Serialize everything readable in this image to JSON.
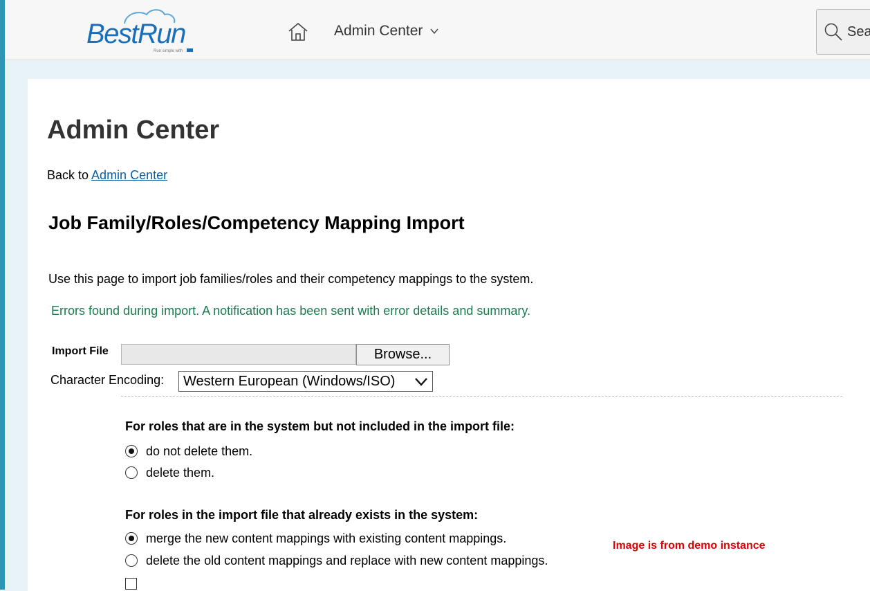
{
  "header": {
    "logo_text": "BestRun",
    "logo_tagline": "Run simple with",
    "nav_label": "Admin Center",
    "search_text": "Sear"
  },
  "page": {
    "title": "Admin Center",
    "back_prefix": "Back to",
    "back_link": "Admin Center",
    "section_title": "Job Family/Roles/Competency Mapping Import",
    "intro": "Use this page to import job families/roles and their competency mappings to the system.",
    "error_message": "Errors found during import. A notification has been sent with error details and summary."
  },
  "form": {
    "import_label": "Import File",
    "file_value": "",
    "browse_label": "Browse...",
    "encoding_label": "Character Encoding:",
    "encoding_value": "Western European (Windows/ISO)",
    "group1_title": "For roles that are in the system but not included in the import file:",
    "group1_options": [
      {
        "label": "do not delete them.",
        "checked": true
      },
      {
        "label": "delete them.",
        "checked": false
      }
    ],
    "group2_title": "For roles in the import file that already exists in the system:",
    "group2_options": [
      {
        "label": "merge the new content mappings with existing content mappings.",
        "checked": true
      },
      {
        "label": "delete the old content mappings and replace with new content mappings.",
        "checked": false
      }
    ]
  },
  "note": "Image is from demo instance",
  "colors": {
    "accent_stripe": "#2e96b4",
    "link": "#0b5fa4",
    "success_text": "#1c7a4e",
    "note_text": "#e00000"
  }
}
